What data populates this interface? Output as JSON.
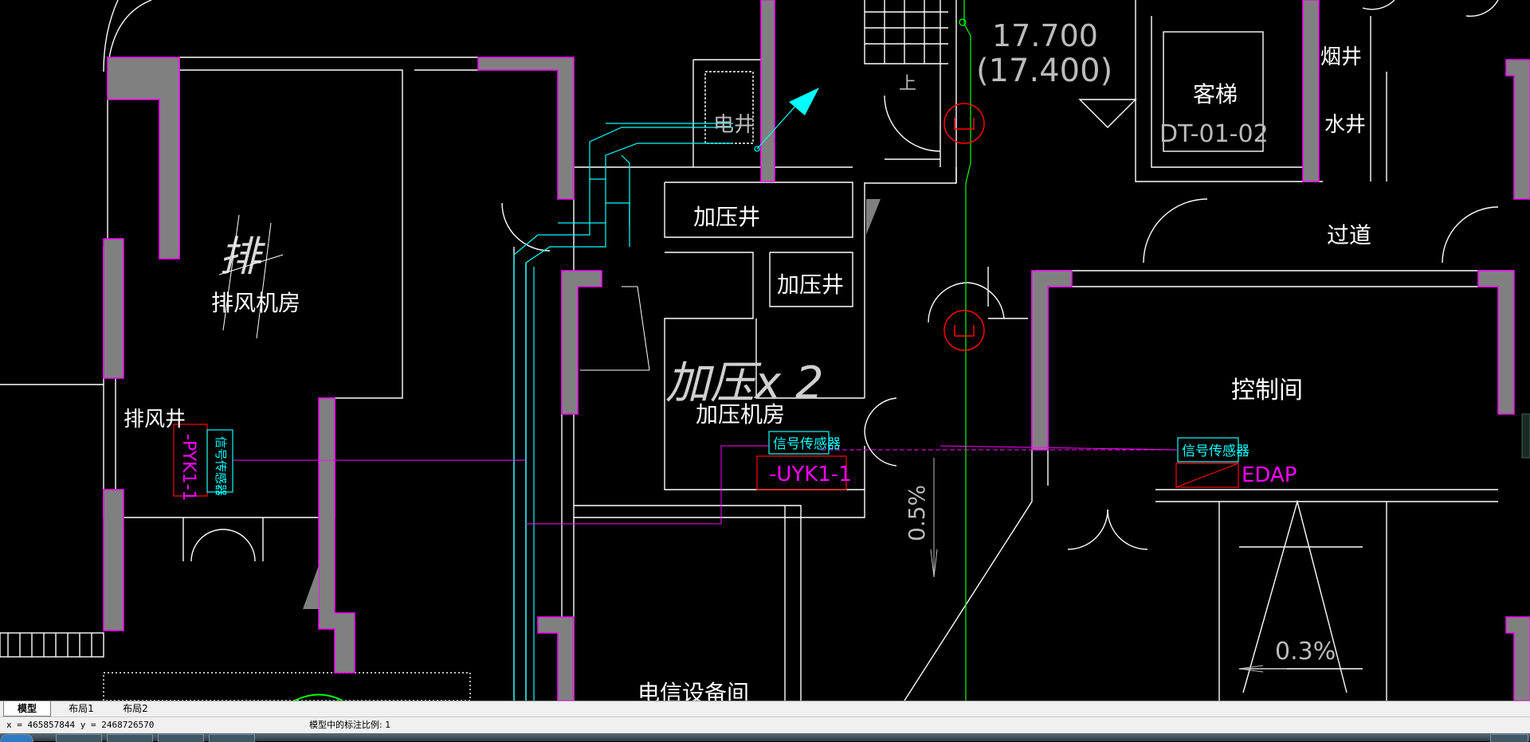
{
  "colors": {
    "background": "#000000",
    "wall": "#ffffff",
    "column_fill": "#808080",
    "column_edge": "#ff00ff",
    "duct": "#00ffff",
    "annotation": "#ff00ff",
    "fire_symbol": "#ff0000",
    "center_line": "#00ff00"
  },
  "icons": {
    "ucs_arrow": "ucs-arrow-icon",
    "fire_valve": "fire-valve-circle-icon"
  },
  "drawing": {
    "rooms": {
      "exhaust_room": "排风机房",
      "exhaust_room_handwritten": "排",
      "exhaust_shaft": "排风井",
      "pressure_shaft_1": "加压井",
      "pressure_shaft_2": "加压井",
      "pressure_room": "加压机房",
      "pressure_handwritten": "加压x 2",
      "elevator": "客梯",
      "elevator_code": "DT-01-02",
      "smoke_shaft": "烟井",
      "water_shaft": "水井",
      "electric_shaft": "电井",
      "corridor": "过道",
      "control_room": "控制间",
      "telecom_room": "电信设备间",
      "stair_up": "上"
    },
    "elevations": {
      "level": "17.700",
      "level_paren": "(17.400)"
    },
    "slopes": {
      "slope_a": "0.5%",
      "slope_b": "0.3%"
    },
    "devices": {
      "signal_sensor_1": "信号传感器",
      "signal_sensor_2": "信号传感器",
      "signal_sensor_vertical": "信号传感器",
      "box_uyk": "-UYK1-1",
      "box_pyk": "-PYK1-1",
      "edap": "EDAP"
    }
  },
  "layout_tabs": [
    {
      "label": "模型",
      "active": true
    },
    {
      "label": "布局1",
      "active": false
    },
    {
      "label": "布局2",
      "active": false
    }
  ],
  "statusbar": {
    "coords": "x = 465857844  y = 2468726570",
    "annotation_scale": "模型中的标注比例: 1"
  }
}
